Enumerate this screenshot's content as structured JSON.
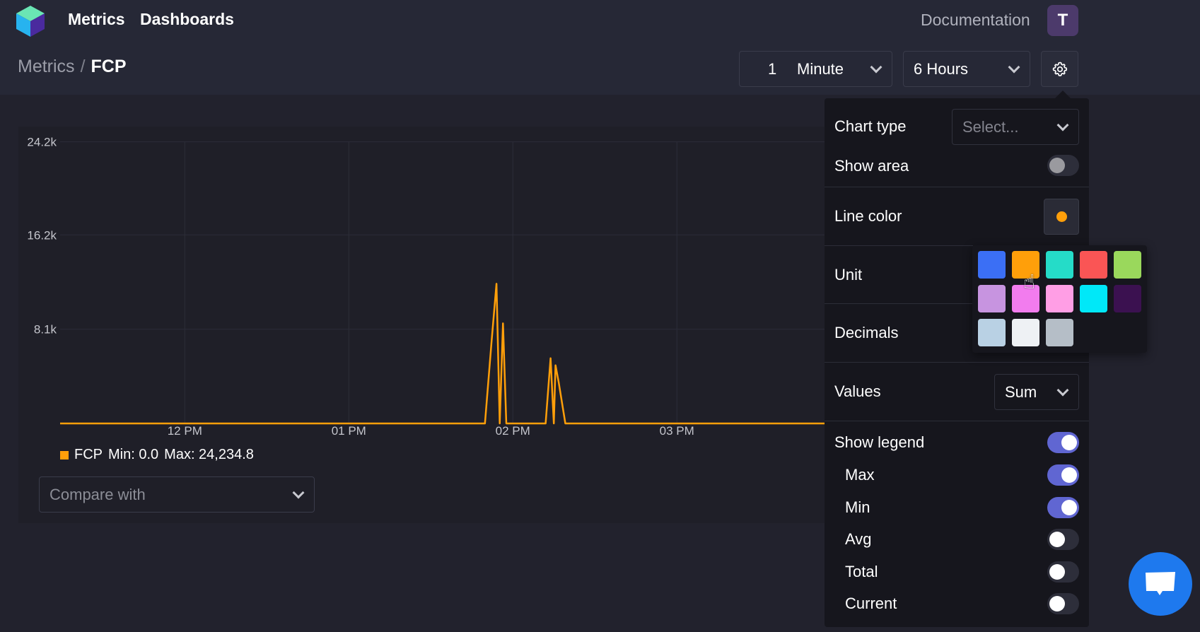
{
  "header": {
    "nav": [
      "Metrics",
      "Dashboards"
    ],
    "documentation": "Documentation",
    "avatar_initial": "T",
    "breadcrumb": {
      "root": "Metrics",
      "separator": "/",
      "current": "FCP"
    },
    "interval": {
      "value": "1",
      "unit": "Minute"
    },
    "range": "6 Hours",
    "settings_icon": "gear-icon"
  },
  "chart": {
    "legend": {
      "series": "FCP",
      "min": "Min: 0.0",
      "max": "Max: 24,234.8"
    },
    "compare_placeholder": "Compare with"
  },
  "chart_data": {
    "type": "line",
    "title": "FCP",
    "xlabel": "",
    "ylabel": "",
    "ylim": [
      0,
      24234.8
    ],
    "y_ticks": [
      "24.2k",
      "16.2k",
      "8.1k"
    ],
    "y_tick_values": [
      24200,
      16200,
      8100
    ],
    "x_ticks": [
      "12 PM",
      "01 PM",
      "02 PM",
      "03 PM"
    ],
    "x_tick_hours": [
      12,
      13,
      14,
      15
    ],
    "xlim_hours": [
      11.24,
      15.9
    ],
    "grid": true,
    "legend": "bottom-left",
    "series": [
      {
        "name": "FCP",
        "color": "#ff9f0a",
        "x_hours": [
          11.24,
          13.83,
          13.87,
          13.9,
          13.92,
          13.94,
          13.96,
          13.99,
          14.2,
          14.23,
          14.25,
          14.26,
          14.28,
          14.32,
          15.9
        ],
        "values": [
          0,
          0,
          7000,
          12000,
          0,
          8600,
          0,
          0,
          0,
          5600,
          0,
          5000,
          3500,
          0,
          0
        ]
      }
    ]
  },
  "settings": {
    "chart_type": {
      "label": "Chart type",
      "placeholder": "Select..."
    },
    "show_area": {
      "label": "Show area",
      "on": false
    },
    "line_color": {
      "label": "Line color",
      "value": "#ff9f0a"
    },
    "unit": {
      "label": "Unit"
    },
    "decimals": {
      "label": "Decimals"
    },
    "values": {
      "label": "Values",
      "selected": "Sum"
    },
    "show_legend": {
      "label": "Show legend",
      "on": true
    },
    "legend_items": [
      {
        "label": "Max",
        "on": true
      },
      {
        "label": "Min",
        "on": true
      },
      {
        "label": "Avg",
        "on": false
      },
      {
        "label": "Total",
        "on": false
      },
      {
        "label": "Current",
        "on": false
      }
    ]
  },
  "palette": {
    "colors": [
      "#3b6ff5",
      "#ff9f0a",
      "#25dcc8",
      "#fa5555",
      "#9ad85c",
      "#c794e0",
      "#f27cee",
      "#ff9ee5",
      "#00e8f8",
      "#3b1150",
      "#b9d1e4",
      "#eef1f4",
      "#b5bec7"
    ],
    "hovered_index": 1
  },
  "theme": {
    "toggle_on": "#6066d2",
    "accent": "#ff9f0a",
    "chat_button": "#1e79ee"
  }
}
